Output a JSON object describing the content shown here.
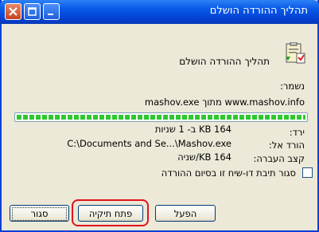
{
  "window": {
    "title": "תהליך ההורדה הושלם"
  },
  "header": {
    "message": "תהליך ההורדה הושלם"
  },
  "details": {
    "saved_label": "נשמר:",
    "saved_value": "www.mashov.info מתוך mashov.exe",
    "progress_fraction": 1.0,
    "downloaded_label": "ירד:",
    "downloaded_value": "164 KB ב- 1 שניות",
    "download_to_label": "הורד אל:",
    "download_to_value": "C:\\Documents and Se...\\Mashov.exe",
    "rate_label": "קצב העברה:",
    "rate_value": "164 KB/שניה"
  },
  "checkbox": {
    "label": "סגור תיבת דו-שיח זו בסיום ההורדה",
    "checked": false
  },
  "buttons": {
    "run": "הפעל",
    "open_folder": "פתח תיקיה",
    "close": "סגור"
  },
  "colors": {
    "titlebar": "#0a5be9",
    "progress": "#2fc72f",
    "highlight": "#e0141b"
  }
}
